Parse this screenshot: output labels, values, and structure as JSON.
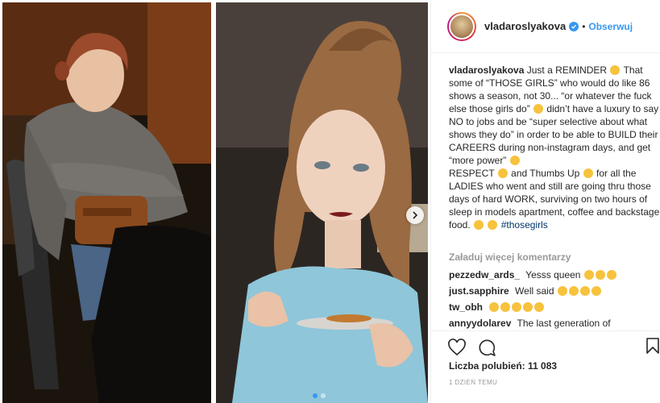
{
  "post": {
    "username": "vladaroslyakova",
    "follow_label": "Obserwuj",
    "separator": "•"
  },
  "caption": {
    "username": "vladaroslyakova",
    "text_1": "Just a REMINDER",
    "text_2": "That some of “THOSE GIRLS” who would do like 86 shows a season, not 30... “or whatever the fuck else those girls do”",
    "text_3": "didn’t have a luxury to say NO to jobs and be “super selective about what shows they do” in order to be able to BUILD their CAREERS during non-instagram days, and get “more power”",
    "text_4": "RESPECT",
    "text_5": "and Thumbs Up",
    "text_6": "for all the LADIES who went and still are going thru those days of hard WORK, surviving on two hours of sleep in models apartment, coffee and backstage food.",
    "hashtag": "#thosegirls"
  },
  "load_more_label": "Załaduj więcej komentarzy",
  "comments": [
    {
      "user": "pezzedw_ards_",
      "text": "Yesss queen"
    },
    {
      "user": "just.sapphire",
      "text": "Well said"
    },
    {
      "user": "tw_obh",
      "text": ""
    },
    {
      "user": "annyydolarev",
      "text": "The last generation of"
    }
  ],
  "likes_label": "Liczba polubień: 11 083",
  "timestamp": "1 DZIEŃ TEMU",
  "icons": {
    "like": "heart-icon",
    "comment": "comment-icon",
    "save": "bookmark-icon",
    "next": "chevron-right-icon"
  },
  "colors": {
    "accent": "#3897f0",
    "muted": "#999999",
    "text": "#262626"
  }
}
